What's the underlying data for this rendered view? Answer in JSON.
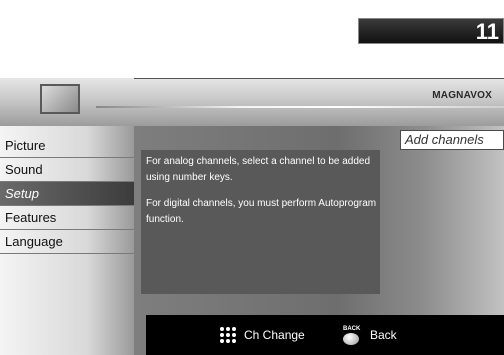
{
  "page_number": "11",
  "header": {
    "brand": "MAGNAVOX"
  },
  "menu": {
    "items": [
      {
        "label": "Picture",
        "selected": false
      },
      {
        "label": "Sound",
        "selected": false
      },
      {
        "label": "Setup",
        "selected": true
      },
      {
        "label": "Features",
        "selected": false
      },
      {
        "label": "Language",
        "selected": false
      }
    ]
  },
  "content": {
    "option_label": "Add channels",
    "message_lines": [
      "For analog channels, select a channel to be added using number keys.",
      "For digital channels, you must perform Autoprogram function."
    ]
  },
  "footer": {
    "ch_change_label": "Ch Change",
    "back_icon_text": "BACK",
    "back_label": "Back"
  },
  "icons": {
    "tv": "tv-icon",
    "keypad": "keypad-icon",
    "back": "back-button-icon"
  }
}
